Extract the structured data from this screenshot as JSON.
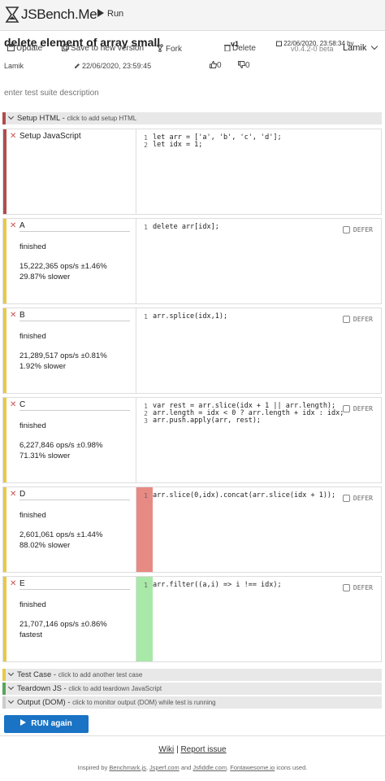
{
  "header": {
    "brand": "JSBench.Me",
    "run_label": "Run"
  },
  "suite": {
    "title": "delete element of array small",
    "update_label": "Update",
    "save_new_label": "Save to new version",
    "fork_label": "Fork",
    "delete_label": "Delete",
    "version_tag": "v1",
    "version_date": "22/06/2020, 23:58:34",
    "version_by": "by",
    "app_version": "v0.4.2-0 beta",
    "user": "Lamik",
    "author": "Lamik",
    "edited_date": "22/06/2020, 23:59:45",
    "likes": "0",
    "dislikes": "0",
    "description_placeholder": "enter test suite description"
  },
  "setup_html": {
    "label": "Setup HTML",
    "hint": "click to add setup HTML"
  },
  "setup_js": {
    "label": "Setup JavaScript",
    "code": [
      "let arr = ['a', 'b', 'c', 'd'];",
      "let idx = 1;"
    ]
  },
  "cases": [
    {
      "name": "A",
      "status": "finished",
      "ops": "15,222,365 ops/s ±1.46%",
      "rel": "29.87% slower",
      "code": [
        "delete arr[idx];"
      ],
      "defer": "DEFER"
    },
    {
      "name": "B",
      "status": "finished",
      "ops": "21,289,517 ops/s ±0.81%",
      "rel": "1.92% slower",
      "code": [
        "arr.splice(idx,1);"
      ],
      "defer": "DEFER"
    },
    {
      "name": "C",
      "status": "finished",
      "ops": "6,227,846 ops/s ±0.98%",
      "rel": "71.31% slower",
      "code": [
        "var rest = arr.slice(idx + 1 || arr.length);",
        "arr.length = idx < 0 ? arr.length + idx : idx;",
        "arr.push.apply(arr, rest);"
      ],
      "defer": "DEFER"
    },
    {
      "name": "D",
      "status": "finished",
      "ops": "2,601,061 ops/s ±1.44%",
      "rel": "88.02% slower",
      "code": [
        "arr.slice(0,idx).concat(arr.slice(idx + 1));"
      ],
      "defer": "DEFER"
    },
    {
      "name": "E",
      "status": "finished",
      "ops": "21,707,146 ops/s ±0.86%",
      "rel": "fastest",
      "code": [
        "arr.filter((a,i) => i !== idx);"
      ],
      "defer": "DEFER"
    }
  ],
  "test_case_bar": {
    "label": "Test Case",
    "hint": "click to add another test case"
  },
  "teardown_bar": {
    "label": "Teardown JS",
    "hint": "click to add teardown JavaScript"
  },
  "output_bar": {
    "label": "Output (DOM)",
    "hint": "click to monitor output (DOM) while test is running"
  },
  "run_again_label": "RUN again",
  "footer": {
    "wiki": "Wiki",
    "sep": "|",
    "report": "Report issue",
    "credits_prefix": "Inspired by",
    "credit_1": "Benchmark.js",
    "credit_2": "Jsperf.com",
    "credit_and": "and",
    "credit_3": "Jsfiddle.com",
    "credit_4": "Fontawesome.io",
    "credits_suffix": "icons used."
  },
  "colors": {
    "setup_accent": "#b04d4d",
    "case_accent": "#e8c84a",
    "slowest_strip": "#e88a84",
    "fastest_strip": "#a8e8a8",
    "run_button": "#1a73c4"
  }
}
